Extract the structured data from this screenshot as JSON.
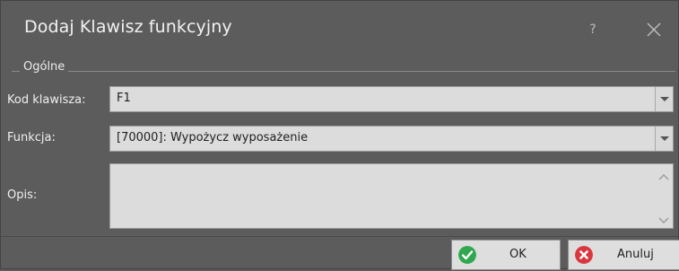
{
  "dialog": {
    "title": "Dodaj Klawisz funkcyjny",
    "help_label": "?",
    "close_icon": "close-icon"
  },
  "group": {
    "legend": "Ogólne"
  },
  "form": {
    "key_code_label": "Kod klawisza:",
    "key_code_value": "F1",
    "function_label": "Funkcja:",
    "function_value": "[70000]: Wypożycz wyposażenie",
    "description_label": "Opis:",
    "description_value": ""
  },
  "buttons": {
    "ok_label": "OK",
    "cancel_label": "Anuluj"
  },
  "colors": {
    "background": "#5c5c5c",
    "field": "#dcdcdc",
    "ok_icon": "#2fa84f",
    "cancel_icon": "#d9363e"
  }
}
